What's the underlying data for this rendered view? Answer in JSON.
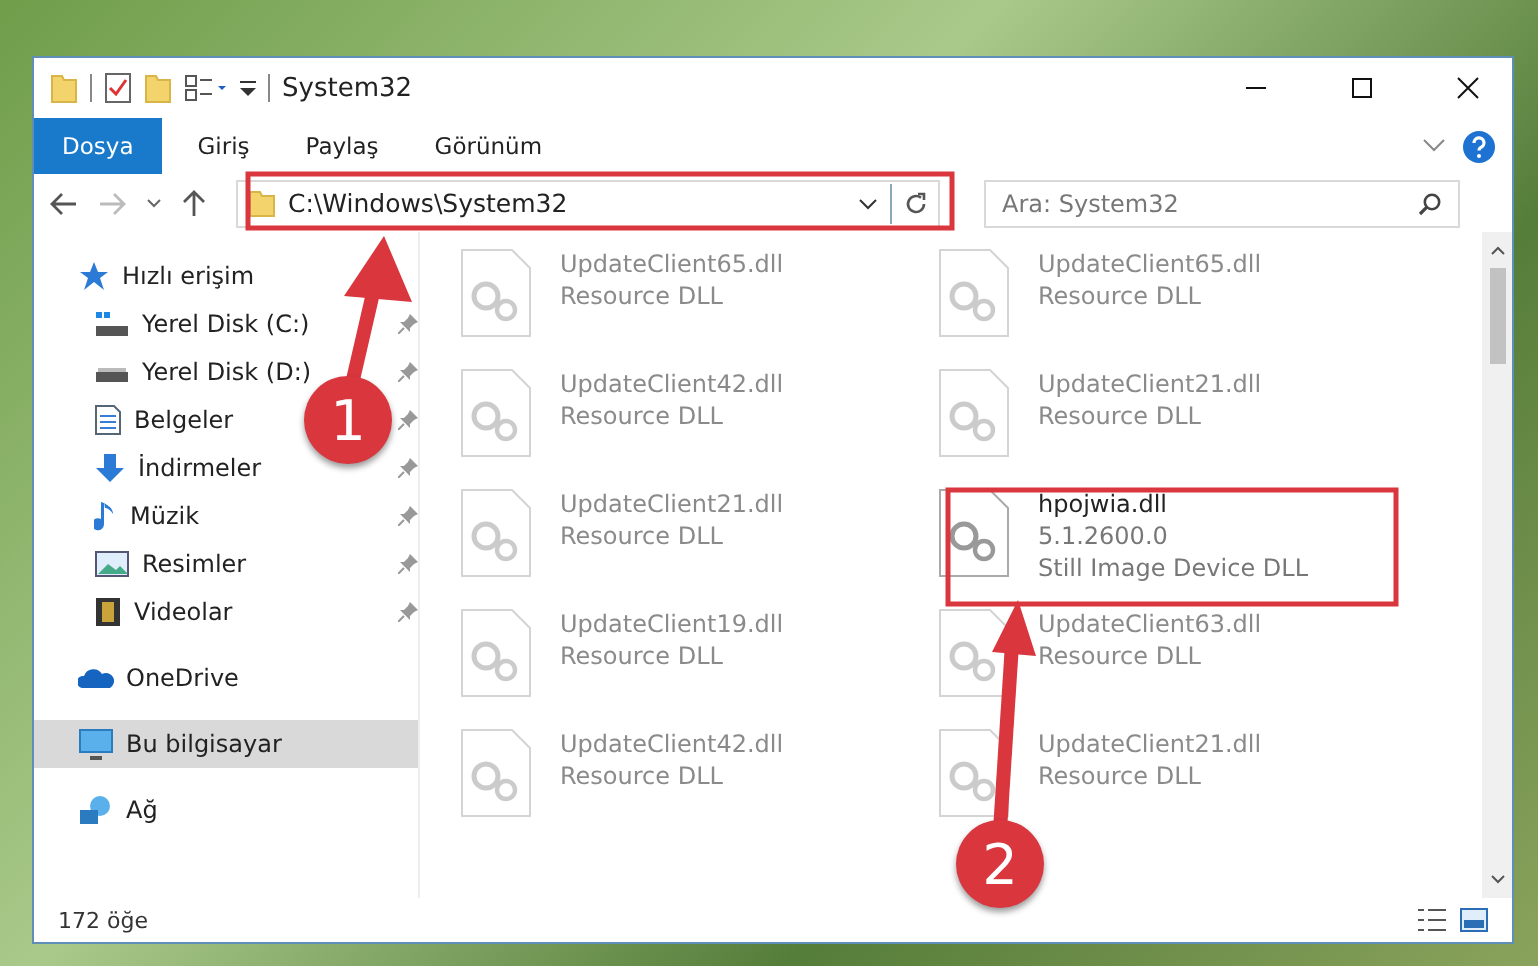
{
  "window": {
    "title": "System32"
  },
  "ribbon_tabs": [
    {
      "label": "Dosya",
      "selected": true
    },
    {
      "label": "Giriş",
      "selected": false
    },
    {
      "label": "Paylaş",
      "selected": false
    },
    {
      "label": "Görünüm",
      "selected": false
    }
  ],
  "address_bar": {
    "path": "C:\\Windows\\System32"
  },
  "search": {
    "placeholder": "Ara: System32"
  },
  "sidebar": {
    "items": [
      {
        "label": "Hızlı erişim",
        "kind": "star",
        "selected": false,
        "children": [
          {
            "label": "Yerel Disk (C:)",
            "kind": "system-drive",
            "pinned": true
          },
          {
            "label": "Yerel Disk (D:)",
            "kind": "drive",
            "pinned": true
          },
          {
            "label": "Belgeler",
            "kind": "document",
            "pinned": true
          },
          {
            "label": "İndirmeler",
            "kind": "download",
            "pinned": true
          },
          {
            "label": "Müzik",
            "kind": "music",
            "pinned": true
          },
          {
            "label": "Resimler",
            "kind": "picture",
            "pinned": true
          },
          {
            "label": "Videolar",
            "kind": "video",
            "pinned": true
          }
        ]
      },
      {
        "label": "OneDrive",
        "kind": "cloud",
        "selected": false
      },
      {
        "label": "Bu bilgisayar",
        "kind": "computer",
        "selected": true
      },
      {
        "label": "Ağ",
        "kind": "network",
        "selected": false
      }
    ]
  },
  "files": [
    {
      "name": "UpdateClient65.dll",
      "description": "Resource DLL",
      "faded": true
    },
    {
      "name": "UpdateClient65.dll",
      "description": "Resource DLL",
      "faded": true
    },
    {
      "name": "UpdateClient42.dll",
      "description": "Resource DLL",
      "faded": true
    },
    {
      "name": "UpdateClient21.dll",
      "description": "Resource DLL",
      "faded": true
    },
    {
      "name": "UpdateClient21.dll",
      "description": "Resource DLL",
      "faded": true
    },
    {
      "name": "hpojwia.dll",
      "version": "5.1.2600.0",
      "description": "Still Image Device DLL",
      "faded": false
    },
    {
      "name": "UpdateClient19.dll",
      "description": "Resource DLL",
      "faded": true
    },
    {
      "name": "UpdateClient63.dll",
      "description": "Resource DLL",
      "faded": true
    },
    {
      "name": "UpdateClient42.dll",
      "description": "Resource DLL",
      "faded": true
    },
    {
      "name": "UpdateClient21.dll",
      "description": "Resource DLL",
      "faded": true
    }
  ],
  "status_bar": {
    "item_count": "172 öğe"
  },
  "annotations": [
    {
      "number": "1"
    },
    {
      "number": "2"
    }
  ]
}
